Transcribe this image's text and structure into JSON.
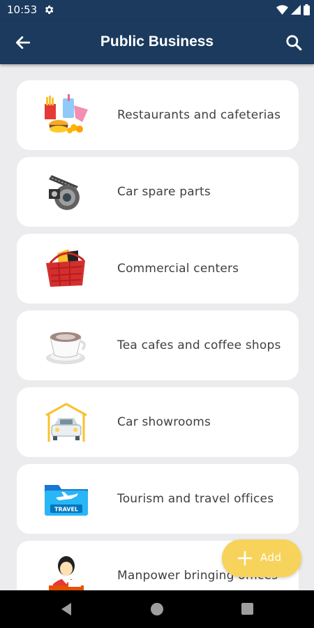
{
  "status_bar": {
    "time": "10:53",
    "icons": [
      "gear-icon",
      "wifi-icon",
      "signal-icon",
      "battery-icon"
    ]
  },
  "app_bar": {
    "title": "Public Business",
    "back_icon": "arrow-left-icon",
    "search_icon": "search-icon",
    "background": "#1b3a5e"
  },
  "categories": [
    {
      "label": "Restaurants and cafeterias",
      "icon": "fast-food-icon"
    },
    {
      "label": "Car spare parts",
      "icon": "car-parts-icon"
    },
    {
      "label": "Commercial centers",
      "icon": "shopping-basket-icon"
    },
    {
      "label": "Tea cafes and coffee shops",
      "icon": "coffee-cup-icon"
    },
    {
      "label": "Car showrooms",
      "icon": "car-showroom-icon"
    },
    {
      "label": "Tourism and travel offices",
      "icon": "travel-folder-icon"
    },
    {
      "label": "Manpower bringing offices",
      "icon": "office-worker-icon"
    }
  ],
  "fab": {
    "label": "Add",
    "icon": "plus-icon",
    "color": "#f7d35b"
  },
  "travel_icon_text": "TRAVEL",
  "nav_bar": {
    "icons": [
      "nav-back-icon",
      "nav-home-icon",
      "nav-recents-icon"
    ]
  }
}
